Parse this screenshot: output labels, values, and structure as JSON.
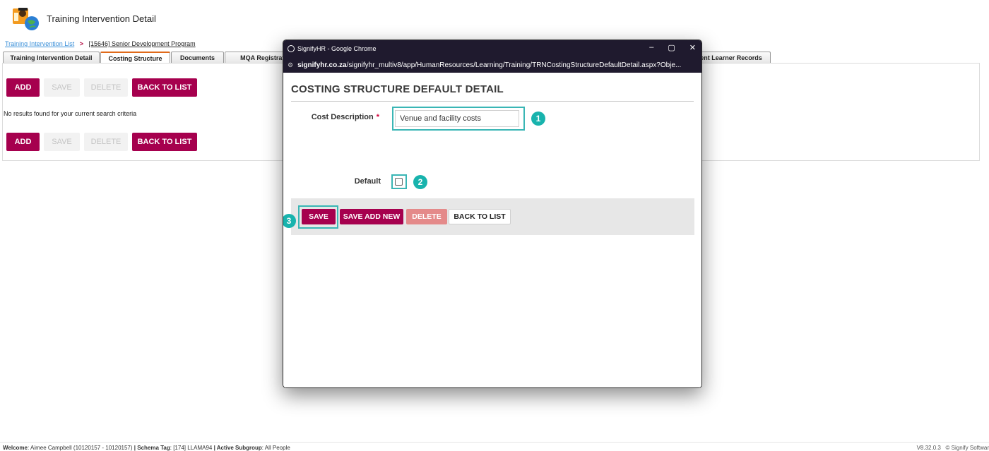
{
  "app": {
    "title": "Training Intervention Detail"
  },
  "breadcrumb": {
    "link": "Training Intervention List",
    "separator": ">",
    "current": "[15646] Senior Development Program"
  },
  "tabs": [
    "Training Intervention Detail",
    "Costing Structure",
    "Documents",
    "MQA Registration",
    "vent Learner Records"
  ],
  "active_tab": "Costing Structure",
  "toolbar": {
    "add": "ADD",
    "save": "SAVE",
    "delete": "DELETE",
    "back": "BACK TO LIST"
  },
  "messages": {
    "no_results": "No results found for your current search criteria"
  },
  "chrome": {
    "window_title": "SignifyHR - Google Chrome",
    "url_host": "signifyhr.co.za",
    "url_path": "/signifyhr_multiv8/app/HumanResources/Learning/Training/TRNCostingStructureDefaultDetail.aspx?Obje...",
    "controls": {
      "minimize": "–",
      "maximize": "▢",
      "close": "✕"
    }
  },
  "modal": {
    "heading": "COSTING STRUCTURE DEFAULT DETAIL",
    "cost_description_label": "Cost Description",
    "required_marker": "*",
    "cost_description_value": "Venue and facility costs",
    "default_label": "Default",
    "default_checked": false,
    "buttons": {
      "save": "SAVE",
      "save_add_new": "SAVE ADD NEW",
      "delete": "DELETE",
      "back": "BACK TO LIST"
    },
    "steps": [
      "1",
      "2",
      "3"
    ]
  },
  "footer": {
    "welcome_label": "Welcome",
    "welcome_value": ": Aimee Campbell (10120157 - 10120157)",
    "schema_label": "| Schema Tag",
    "schema_value": ": [174] LLAMA94",
    "subgroup_label": "| Active Subgroup",
    "subgroup_value": ": All People",
    "version": "V8.32.0.3",
    "copyright": "© Signify Softwar"
  },
  "colors": {
    "primary": "#a6004e",
    "accent_teal": "#18b3ad",
    "tab_active_border": "#e06a1a",
    "chrome_dark": "#1f1a2e"
  }
}
